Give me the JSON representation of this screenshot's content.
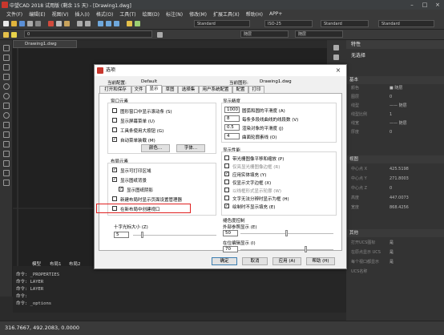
{
  "app": {
    "title": "中望CAD 2018 试用版 (剩余 15 天) - [Drawing1.dwg]"
  },
  "menu": [
    "文件(F)",
    "编辑(E)",
    "视图(V)",
    "插入(I)",
    "格式(O)",
    "工具(T)",
    "绘图(D)",
    "标注(N)",
    "修改(M)",
    "扩展工具(X)",
    "帮助(H)",
    "APP+"
  ],
  "toolbar": {
    "style1": "Standard",
    "style2": "ISO-25",
    "style3": "Standard",
    "style4": "Standard",
    "layer": "0",
    "color": "随层",
    "linetype": "随层"
  },
  "drawing_tab": "Drawing1.dwg",
  "properties": {
    "header": "特性",
    "selection": "无选择",
    "sections": {
      "basic": "基本",
      "view": "视图",
      "other": "其他"
    },
    "rows_basic": [
      {
        "k": "颜色",
        "v": "■ 随层"
      },
      {
        "k": "图层",
        "v": "0"
      },
      {
        "k": "线型",
        "v": "—— 随层"
      },
      {
        "k": "线型比例",
        "v": "1"
      },
      {
        "k": "线宽",
        "v": "—— 随层"
      },
      {
        "k": "厚度",
        "v": "0"
      }
    ],
    "rows_view": [
      {
        "k": "中心点 X",
        "v": "425.5198"
      },
      {
        "k": "中心点 Y",
        "v": "271.8003"
      },
      {
        "k": "中心点 Z",
        "v": "0"
      },
      {
        "k": "高度",
        "v": "447.0073"
      },
      {
        "k": "宽度",
        "v": "868.4256"
      }
    ],
    "rows_other": [
      {
        "k": "打开UCS图标",
        "v": "是"
      },
      {
        "k": "在原点显示 UCS",
        "v": "是"
      },
      {
        "k": "每个视口都显示",
        "v": "是"
      },
      {
        "k": "UCS名称",
        "v": ""
      }
    ]
  },
  "layout_tabs": {
    "model": "模型",
    "l1": "布局1",
    "l2": "布局2"
  },
  "command_lines": [
    "命令: _PROPERTIES",
    "命令: LAYER",
    "命令: LAYER",
    "命令:",
    "命令: _options"
  ],
  "status": {
    "coords": "316.7667, 492.2083, 0.0000"
  },
  "dialog": {
    "title": "选项",
    "current_profile_label": "当前配置:",
    "current_profile_value": "Default",
    "current_drawing_label": "当前图形:",
    "current_drawing_value": "Drawing1.dwg",
    "tabs": [
      "打开和保存",
      "文件",
      "显示",
      "草图",
      "选择集",
      "用户系统配置",
      "配置",
      "打印"
    ],
    "window_elements": {
      "title": "窗口元素",
      "items": [
        {
          "label": "图形窗口中显示滚动条 (S)",
          "checked": false
        },
        {
          "label": "显示屏幕菜单 (U)",
          "checked": false
        },
        {
          "label": "工具条使用大按钮 (G)",
          "checked": false
        },
        {
          "label": "自动菜单装载 (M)",
          "checked": true
        }
      ],
      "btn_color": "颜色...",
      "btn_font": "字体..."
    },
    "layout_elements": {
      "title": "布局元素",
      "items": [
        {
          "label": "显示可打印区域",
          "checked": true
        },
        {
          "label": "显示图纸背景",
          "checked": true
        },
        {
          "label": "显示图纸阴影",
          "checked": true
        },
        {
          "label": "新建布局时显示页面设置管理器",
          "checked": false
        },
        {
          "label": "在新布局中创建视口",
          "checked": false
        }
      ]
    },
    "crosshair": {
      "title": "十字光标大小 (Z)",
      "value": "5"
    },
    "precision": {
      "title": "显示精度",
      "items": [
        {
          "value": "1000",
          "label": "圆弧和圆的平滑度 (A)"
        },
        {
          "value": "8",
          "label": "每条多段线曲线的线段数 (V)"
        },
        {
          "value": "0.5",
          "label": "渲染对象的平滑度 (J)"
        },
        {
          "value": "4",
          "label": "曲面轮廓素线 (O)"
        }
      ]
    },
    "performance": {
      "title": "显示性能",
      "items": [
        {
          "label": "带光栅图像平移和缩放 (P)",
          "checked": false
        },
        {
          "label": "仅亮显光栅图像边框 (R)",
          "checked": false
        },
        {
          "label": "应用实体填充 (Y)",
          "checked": true
        },
        {
          "label": "仅显示文字边框 (X)",
          "checked": false
        },
        {
          "label": "以线框形式显示轮廓 (W)",
          "checked": false
        },
        {
          "label": "文字无法分辨时显示为框 (H)",
          "checked": false
        },
        {
          "label": "绘制时不显示填充 (E)",
          "checked": true
        }
      ]
    },
    "fade": {
      "title": "褪色度控制",
      "xref_label": "外部参照显示 (E)",
      "xref_value": "50",
      "inplace_label": "在位编辑显示 (I)",
      "inplace_value": "70"
    },
    "buttons": {
      "ok": "确定",
      "cancel": "取消",
      "apply": "应用 (A)",
      "help": "帮助 (H)"
    }
  }
}
